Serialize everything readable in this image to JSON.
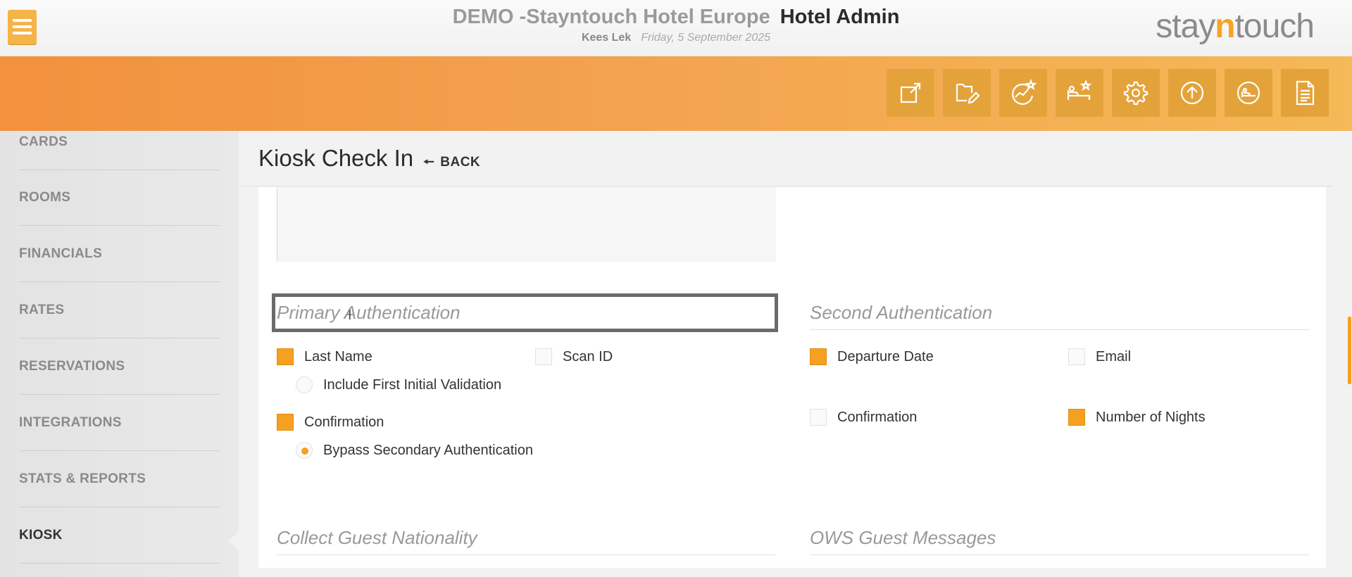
{
  "header": {
    "hotel_name": "DEMO -Stayntouch Hotel Europe",
    "app_name": "Hotel Admin",
    "user": "Kees Lek",
    "date": "Friday, 5 September 2025",
    "logo": {
      "pre": "stay",
      "mid": "n",
      "post": "touch"
    }
  },
  "toolbar": {
    "icons": [
      "external-link-icon",
      "folder-edit-icon",
      "chart-star-icon",
      "bed-star-icon",
      "gear-icon",
      "upload-circle-icon",
      "guest-icon",
      "document-icon"
    ]
  },
  "sidebar": {
    "items": [
      {
        "label": "CARDS"
      },
      {
        "label": "ROOMS"
      },
      {
        "label": "FINANCIALS"
      },
      {
        "label": "RATES"
      },
      {
        "label": "RESERVATIONS"
      },
      {
        "label": "INTEGRATIONS"
      },
      {
        "label": "STATS & REPORTS"
      },
      {
        "label": "KIOSK",
        "active": true
      }
    ]
  },
  "main": {
    "title": "Kiosk Check In",
    "back_label": "BACK",
    "primary_auth": {
      "heading": "Primary Authentication",
      "last_name": {
        "label": "Last Name",
        "checked": true
      },
      "include_first_initial": {
        "label": "Include First Initial Validation",
        "checked": false
      },
      "scan_id": {
        "label": "Scan ID",
        "checked": false
      },
      "confirmation": {
        "label": "Confirmation",
        "checked": true
      },
      "bypass_secondary": {
        "label": "Bypass Secondary Authentication",
        "checked": true
      }
    },
    "second_auth": {
      "heading": "Second Authentication",
      "departure_date": {
        "label": "Departure Date",
        "checked": true
      },
      "email": {
        "label": "Email",
        "checked": false
      },
      "confirmation": {
        "label": "Confirmation",
        "checked": false
      },
      "number_of_nights": {
        "label": "Number of Nights",
        "checked": true
      }
    },
    "collect_nationality": {
      "heading": "Collect Guest Nationality"
    },
    "ows_messages": {
      "heading": "OWS Guest Messages"
    }
  },
  "colors": {
    "accent": "#f5a021",
    "band_start": "#f2913e",
    "band_end": "#f5b957"
  }
}
